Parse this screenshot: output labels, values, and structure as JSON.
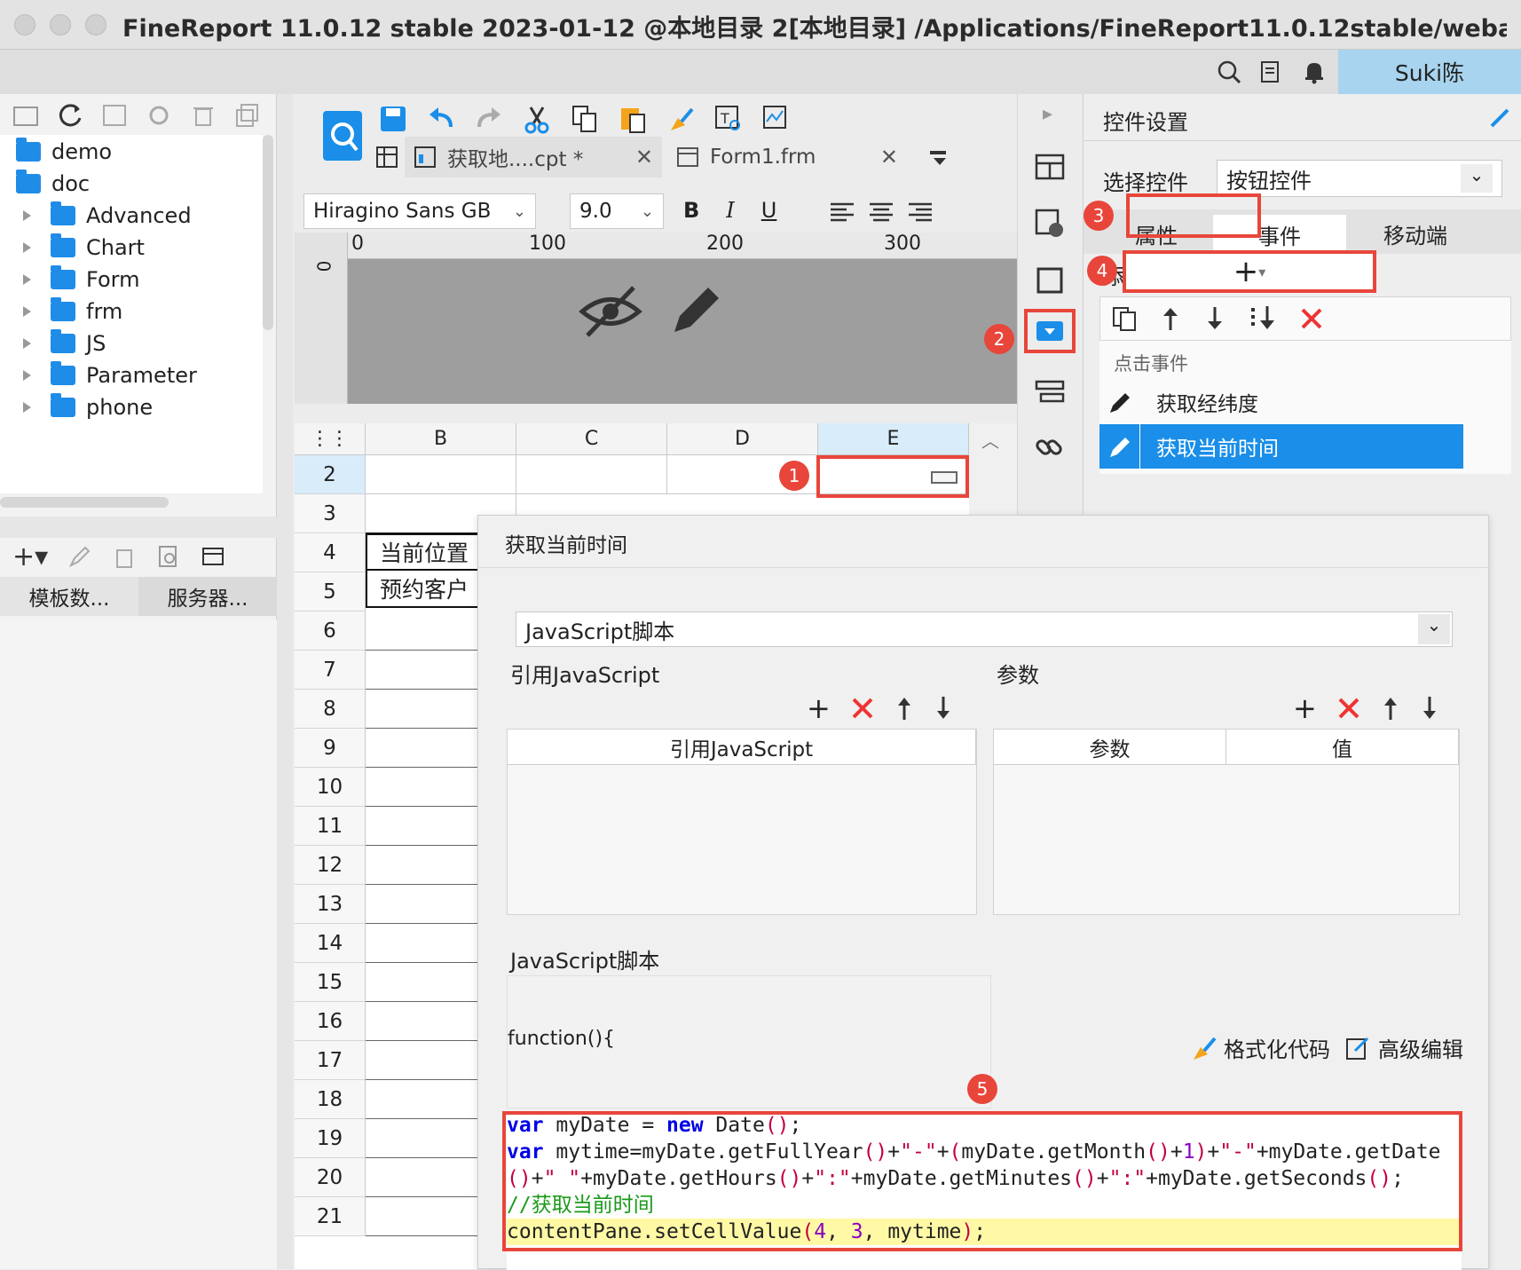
{
  "window": {
    "title": "FineReport 11.0.12 stable 2023-01-12 @本地目录 2[本地目录]   /Applications/FineReport11.0.12stable/webapps/webr...",
    "user": "Suki陈"
  },
  "tree": {
    "items": [
      {
        "label": "demo",
        "level": 0
      },
      {
        "label": "doc",
        "level": 0
      },
      {
        "label": "Advanced",
        "level": 1
      },
      {
        "label": "Chart",
        "level": 1
      },
      {
        "label": "Form",
        "level": 1
      },
      {
        "label": "frm",
        "level": 1
      },
      {
        "label": "JS",
        "level": 1
      },
      {
        "label": "Parameter",
        "level": 1
      },
      {
        "label": "phone",
        "level": 1
      }
    ]
  },
  "left_tabs": {
    "template_data": "模板数...",
    "server": "服务器..."
  },
  "editor_tabs": [
    {
      "label": "获取地....cpt *"
    },
    {
      "label": "Form1.frm"
    }
  ],
  "format": {
    "font": "Hiragino Sans GB",
    "size": "9.0",
    "bold": "B",
    "italic": "I",
    "underline": "U"
  },
  "ruler": {
    "ticks": [
      "0",
      "100",
      "200",
      "300"
    ],
    "vtick": "0"
  },
  "grid": {
    "columns": [
      "B",
      "C",
      "D",
      "E"
    ],
    "rows": [
      "2",
      "3",
      "4",
      "5",
      "6",
      "7",
      "8",
      "9",
      "10",
      "11",
      "12",
      "13",
      "14",
      "15",
      "16",
      "17",
      "18",
      "19",
      "20",
      "21"
    ],
    "cells": {
      "b4": "当前位置",
      "b5": "预约客户"
    }
  },
  "badges": [
    "1",
    "2",
    "3",
    "4",
    "5"
  ],
  "control_settings": {
    "title": "控件设置",
    "select_label": "选择控件",
    "select_value": "按钮控件",
    "tabs": [
      "属性",
      "事件",
      "移动端"
    ],
    "add_event_label": "添加事件",
    "add_event_symbol": "+",
    "event_group": "点击事件",
    "events": [
      "获取经纬度",
      "获取当前时间"
    ]
  },
  "dialog": {
    "title": "获取当前时间",
    "type_value": "JavaScript脚本",
    "ref_js_label": "引用JavaScript",
    "params_label": "参数",
    "ref_js_header": "引用JavaScript",
    "param_header": "参数",
    "value_header": "值",
    "script_label": "JavaScript脚本",
    "function_head": "function(){",
    "format_code": "格式化代码",
    "advanced_edit": "高级编辑",
    "code_comment": "//获取当前时间"
  },
  "colors": {
    "accent": "#1a8ee8",
    "highlight": "#e8463b",
    "selected_row": "#1a8ee8"
  }
}
